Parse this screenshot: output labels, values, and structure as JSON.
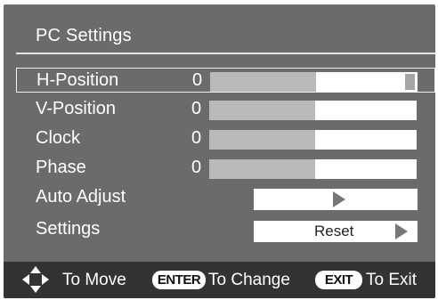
{
  "menu": {
    "title": "PC Settings",
    "rows": [
      {
        "label": "H-Position",
        "value": "0",
        "level": 0.51,
        "selected": true
      },
      {
        "label": "V-Position",
        "value": "0",
        "level": 0.51
      },
      {
        "label": "Clock",
        "value": "0",
        "level": 0.51
      },
      {
        "label": "Phase",
        "value": "0",
        "level": 0.51
      },
      {
        "label": "Auto Adjust",
        "action": ""
      },
      {
        "label": "Settings",
        "action": "Reset"
      }
    ]
  },
  "footer": {
    "move_label": "To Move",
    "enter_key": "ENTER",
    "enter_label": "To Change",
    "exit_key": "EXIT",
    "exit_label": "To Exit"
  },
  "icons": {
    "navigate": "dpad-arrows-icon",
    "action": "triangle-right-icon"
  },
  "colors": {
    "panel": "#6b6b6b",
    "footer": "#333333",
    "slider_fill": "#b9b9b9",
    "slider_track": "#ffffff"
  }
}
